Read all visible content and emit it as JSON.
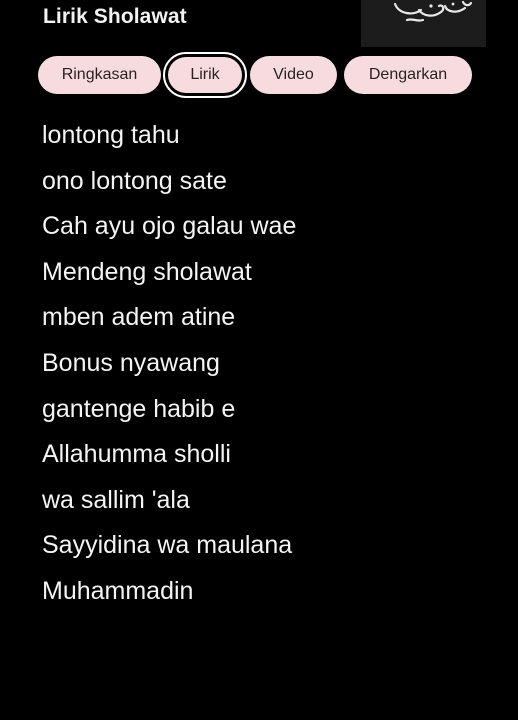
{
  "header": {
    "title": "Lirik Sholawat"
  },
  "tabs": [
    {
      "label": "Ringkasan",
      "selected": false
    },
    {
      "label": "Lirik",
      "selected": true
    },
    {
      "label": "Video",
      "selected": false
    },
    {
      "label": "Dengarkan",
      "selected": false
    }
  ],
  "lyrics": [
    "lontong tahu",
    "ono lontong sate",
    "Cah ayu ojo galau wae",
    "Mendeng sholawat",
    "mben adem atine",
    "Bonus nyawang",
    "gantenge habib e",
    "Allahumma sholli",
    "wa sallim 'ala",
    "Sayyidina wa maulana",
    "Muhammadin"
  ],
  "colors": {
    "background": "#000000",
    "chip": "#f7dcdf",
    "chip_text": "#2a1f21",
    "text": "#f4f4f4"
  },
  "icons": {
    "thumbnail": "calligraphy-thumbnail"
  }
}
